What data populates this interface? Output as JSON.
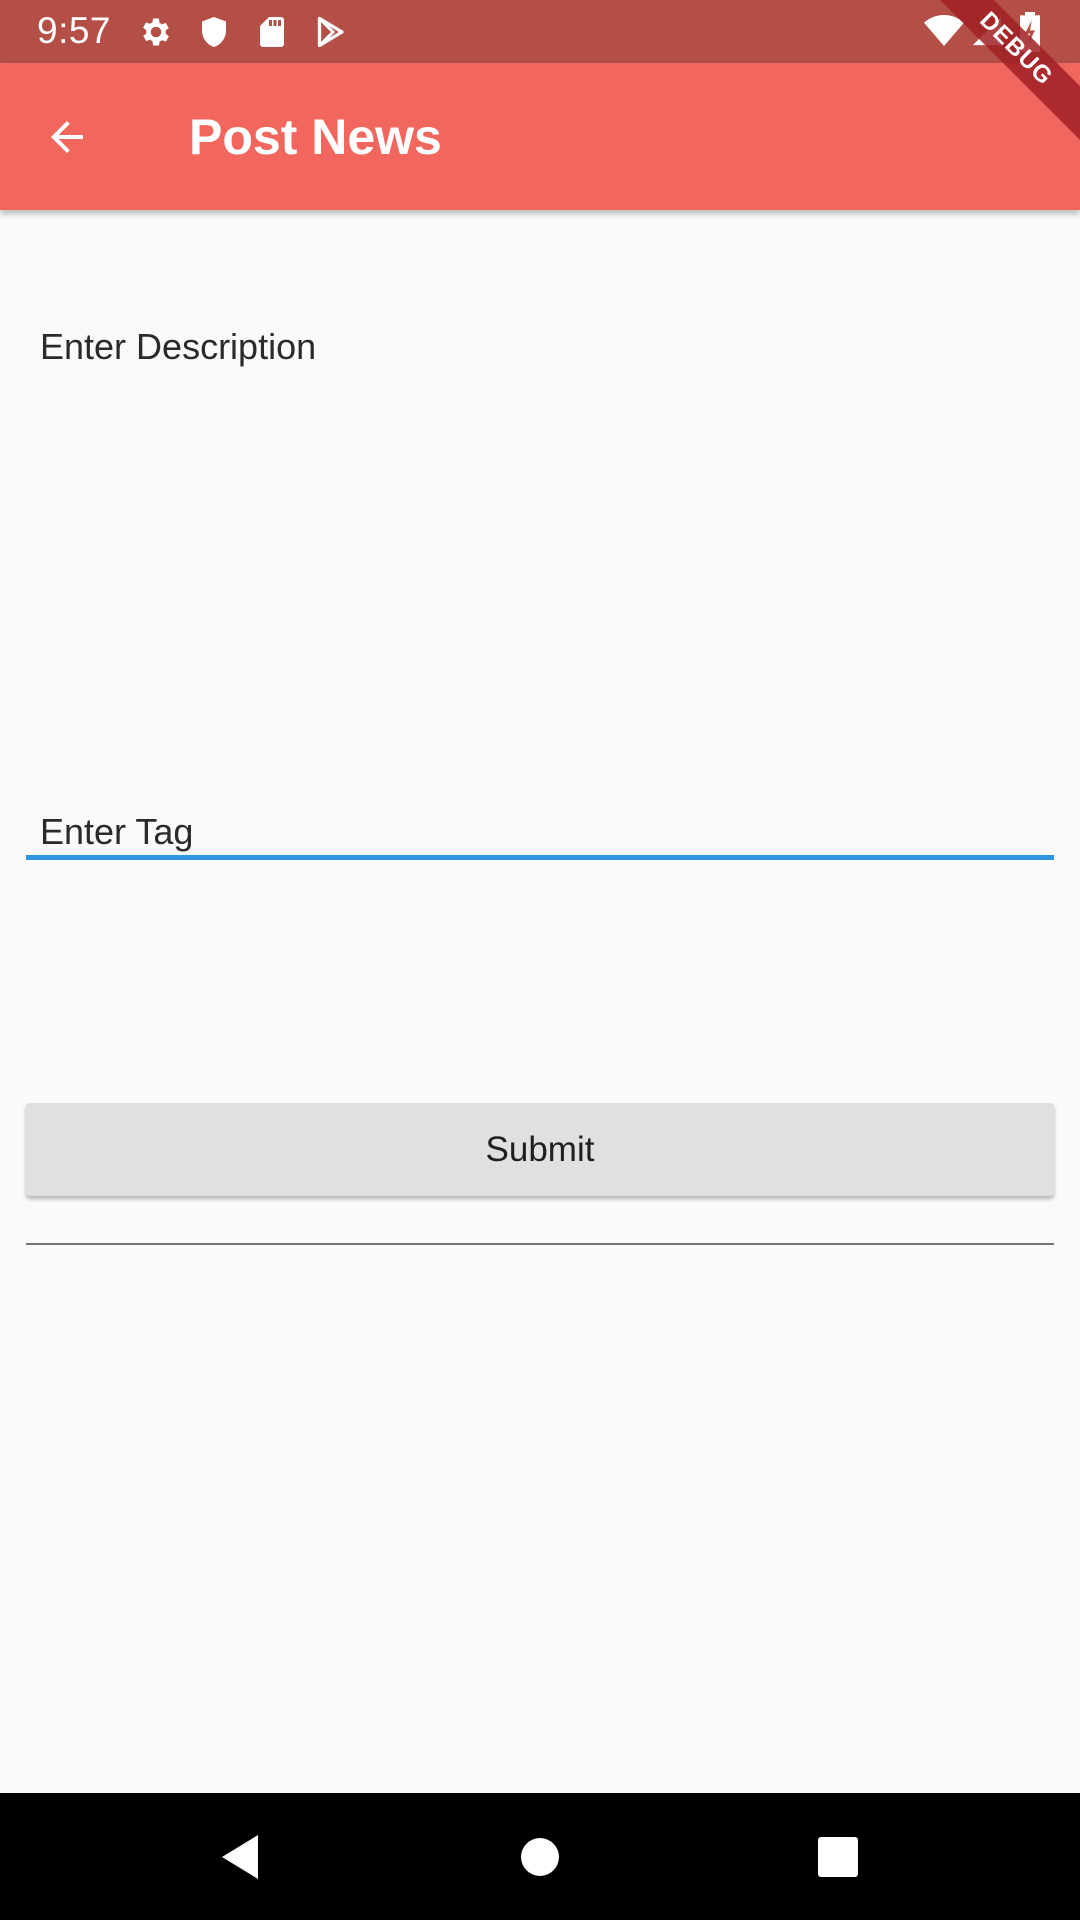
{
  "status_bar": {
    "time": "9:57",
    "left_icons": [
      "gear-icon",
      "shield-icon",
      "sd-card-icon",
      "play-store-icon"
    ],
    "right_icons": [
      "wifi-icon",
      "cell-signal-icon",
      "battery-charging-icon"
    ],
    "background": "#b44f47"
  },
  "app_bar": {
    "title": "Post News",
    "back_icon": "arrow-back-icon",
    "background": "#f2675d"
  },
  "debug_banner": {
    "label": "DEBUG"
  },
  "form": {
    "description": {
      "label": "Enter Description",
      "value": "",
      "underline_color": "#2f95e0",
      "focused": true
    },
    "tag": {
      "label": "Enter Tag",
      "value": "",
      "underline_color": "#757575",
      "focused": false
    },
    "submit_label": "Submit"
  },
  "nav_bar": {
    "buttons": [
      "back-triangle-icon",
      "home-circle-icon",
      "recents-square-icon"
    ]
  }
}
